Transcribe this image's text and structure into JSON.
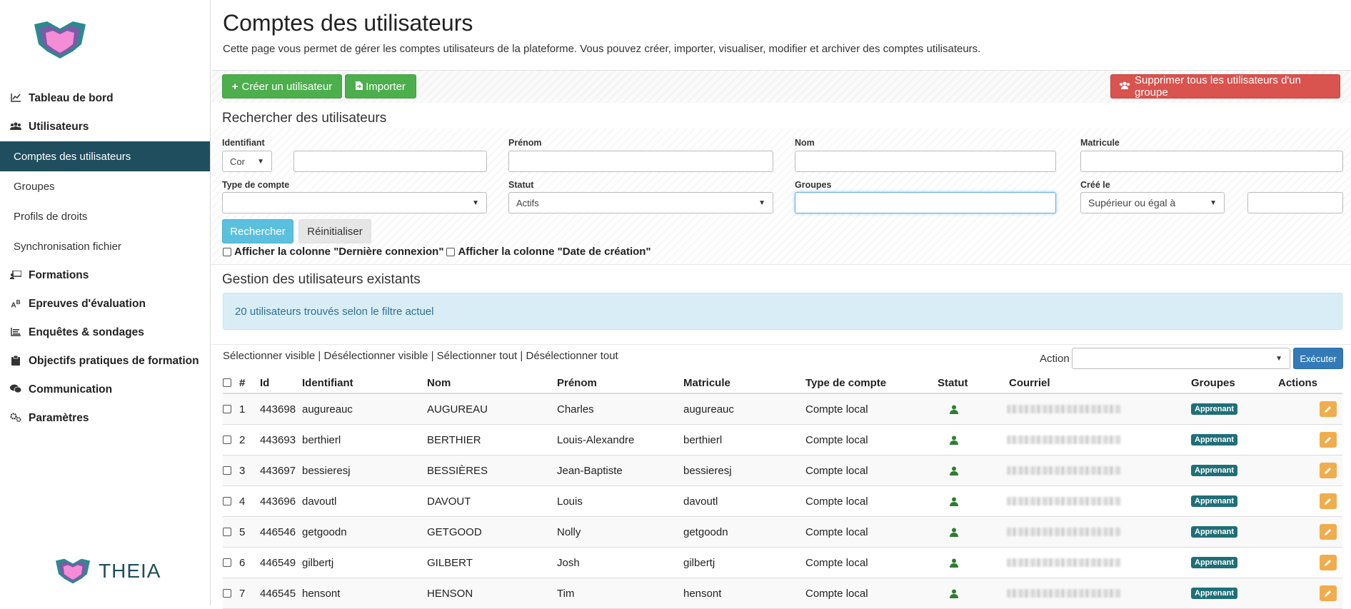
{
  "sidebar": {
    "brand": "THEIA",
    "nav": [
      {
        "label": "Tableau de bord",
        "icon": "chart-line-icon"
      },
      {
        "label": "Utilisateurs",
        "icon": "users-icon"
      },
      {
        "label": "Formations",
        "icon": "chalkboard-icon"
      },
      {
        "label": "Epreuves d'évaluation",
        "icon": "ab-icon"
      },
      {
        "label": "Enquêtes & sondages",
        "icon": "list-icon"
      },
      {
        "label": "Objectifs pratiques de formation",
        "icon": "clipboard-icon"
      },
      {
        "label": "Communication",
        "icon": "comments-icon"
      },
      {
        "label": "Paramètres",
        "icon": "cogs-icon"
      }
    ],
    "sub": [
      {
        "label": "Comptes des utilisateurs",
        "active": true
      },
      {
        "label": "Groupes"
      },
      {
        "label": "Profils de droits"
      },
      {
        "label": "Synchronisation fichier"
      }
    ]
  },
  "page": {
    "title": "Comptes des utilisateurs",
    "description": "Cette page vous permet de gérer les comptes utilisateurs de la plateforme. Vous pouvez créer, importer, visualiser, modifier et archiver des comptes utilisateurs."
  },
  "toolbar": {
    "create_label": "Créer un utilisateur",
    "import_label": "Importer",
    "delete_group_label": "Supprimer tous les utilisateurs d'un groupe"
  },
  "search": {
    "title": "Rechercher des utilisateurs",
    "identifiant_label": "Identifiant",
    "identifiant_mode": "Cor",
    "identifiant_value": "",
    "prenom_label": "Prénom",
    "nom_label": "Nom",
    "matricule_label": "Matricule",
    "type_label": "Type de compte",
    "type_value": "",
    "statut_label": "Statut",
    "statut_value": "Actifs",
    "groupes_label": "Groupes",
    "cree_label": "Créé le",
    "cree_mode": "Supérieur ou égal à",
    "search_button": "Rechercher",
    "reset_button": "Réinitialiser",
    "show_last_login": "Afficher la colonne \"Dernière connexion\"",
    "show_creation_date": "Afficher la colonne \"Date de création\""
  },
  "manage": {
    "title": "Gestion des utilisateurs existants",
    "alert": "20 utilisateurs trouvés selon le filtre actuel",
    "select_visible": "Sélectionner visible",
    "deselect_visible": "Désélectionner visible",
    "select_all": "Sélectionner tout",
    "deselect_all": "Désélectionner tout",
    "separator": "|",
    "action_label": "Action",
    "execute_label": "Exécuter"
  },
  "table": {
    "headers": {
      "num": "#",
      "id": "Id",
      "identifiant": "Identifiant",
      "nom": "Nom",
      "prenom": "Prénom",
      "matricule": "Matricule",
      "type": "Type de compte",
      "statut": "Statut",
      "courriel": "Courriel",
      "groupes": "Groupes",
      "actions": "Actions"
    },
    "rows": [
      {
        "num": "1",
        "id": "443698",
        "identifiant": "augureauc",
        "nom": "AUGUREAU",
        "prenom": "Charles",
        "matricule": "augureauc",
        "type": "Compte local",
        "groupe": "Apprenant"
      },
      {
        "num": "2",
        "id": "443693",
        "identifiant": "berthierl",
        "nom": "BERTHIER",
        "prenom": "Louis-Alexandre",
        "matricule": "berthierl",
        "type": "Compte local",
        "groupe": "Apprenant"
      },
      {
        "num": "3",
        "id": "443697",
        "identifiant": "bessieresj",
        "nom": "BESSIÈRES",
        "prenom": "Jean-Baptiste",
        "matricule": "bessieresj",
        "type": "Compte local",
        "groupe": "Apprenant"
      },
      {
        "num": "4",
        "id": "443696",
        "identifiant": "davoutl",
        "nom": "DAVOUT",
        "prenom": "Louis",
        "matricule": "davoutl",
        "type": "Compte local",
        "groupe": "Apprenant"
      },
      {
        "num": "5",
        "id": "446546",
        "identifiant": "getgoodn",
        "nom": "GETGOOD",
        "prenom": "Nolly",
        "matricule": "getgoodn",
        "type": "Compte local",
        "groupe": "Apprenant"
      },
      {
        "num": "6",
        "id": "446549",
        "identifiant": "gilbertj",
        "nom": "GILBERT",
        "prenom": "Josh",
        "matricule": "gilbertj",
        "type": "Compte local",
        "groupe": "Apprenant"
      },
      {
        "num": "7",
        "id": "446545",
        "identifiant": "hensont",
        "nom": "HENSON",
        "prenom": "Tim",
        "matricule": "hensont",
        "type": "Compte local",
        "groupe": "Apprenant"
      }
    ]
  },
  "colors": {
    "sidebar_active": "#1f4e5f",
    "green": "#4cae4c",
    "red": "#d9534f",
    "info": "#5bc0de",
    "badge": "#1f6f78",
    "status_active": "#2e7d32",
    "edit": "#f0ad4e"
  }
}
